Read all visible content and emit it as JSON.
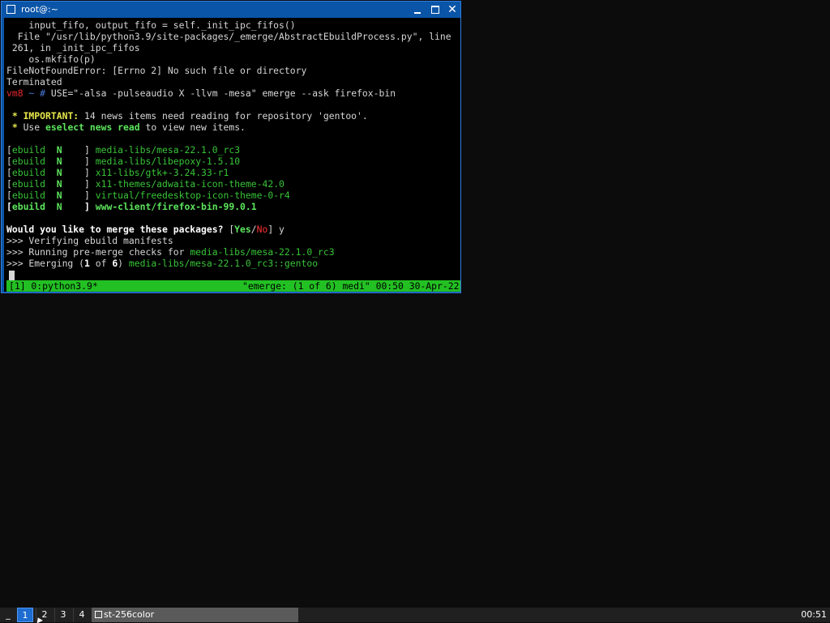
{
  "window": {
    "title": "root@:~"
  },
  "terminal": {
    "lines": [
      [
        {
          "t": "    input_fifo, output_fifo = self._init_ipc_fifos()",
          "c": ""
        }
      ],
      [
        {
          "t": "  File \"/usr/lib/python3.9/site-packages/_emerge/AbstractEbuildProcess.py\", line",
          "c": ""
        }
      ],
      [
        {
          "t": " 261, in _init_ipc_fifos",
          "c": ""
        }
      ],
      [
        {
          "t": "    os.mkfifo(p)",
          "c": ""
        }
      ],
      [
        {
          "t": "FileNotFoundError: [Errno 2] No such file or directory",
          "c": ""
        }
      ],
      [
        {
          "t": "Terminated",
          "c": ""
        }
      ],
      [
        {
          "t": "vm8",
          "c": "red"
        },
        {
          "t": " ~ # ",
          "c": "blue"
        },
        {
          "t": "USE=\"-alsa -pulseaudio X -llvm -mesa\" emerge --ask firefox-bin",
          "c": ""
        }
      ],
      [
        {
          "t": "",
          "c": ""
        }
      ],
      [
        {
          "t": " * ",
          "c": "yellow"
        },
        {
          "t": "IMPORTANT:",
          "c": "yellow"
        },
        {
          "t": " 14 news items need reading for repository 'gentoo'.",
          "c": ""
        }
      ],
      [
        {
          "t": " * ",
          "c": "yellow"
        },
        {
          "t": "Use ",
          "c": ""
        },
        {
          "t": "eselect news read",
          "c": "bgreen"
        },
        {
          "t": " to view new items.",
          "c": ""
        }
      ],
      [
        {
          "t": "",
          "c": ""
        }
      ],
      [
        {
          "t": "[",
          "c": ""
        },
        {
          "t": "ebuild",
          "c": "green"
        },
        {
          "t": "  ",
          "c": ""
        },
        {
          "t": "N",
          "c": "bgreen"
        },
        {
          "t": "    ] ",
          "c": ""
        },
        {
          "t": "media-libs/mesa-22.1.0_rc3",
          "c": "green"
        }
      ],
      [
        {
          "t": "[",
          "c": ""
        },
        {
          "t": "ebuild",
          "c": "green"
        },
        {
          "t": "  ",
          "c": ""
        },
        {
          "t": "N",
          "c": "bgreen"
        },
        {
          "t": "    ] ",
          "c": ""
        },
        {
          "t": "media-libs/libepoxy-1.5.10",
          "c": "green"
        }
      ],
      [
        {
          "t": "[",
          "c": ""
        },
        {
          "t": "ebuild",
          "c": "green"
        },
        {
          "t": "  ",
          "c": ""
        },
        {
          "t": "N",
          "c": "bgreen"
        },
        {
          "t": "    ] ",
          "c": ""
        },
        {
          "t": "x11-libs/gtk+-3.24.33-r1",
          "c": "green"
        }
      ],
      [
        {
          "t": "[",
          "c": ""
        },
        {
          "t": "ebuild",
          "c": "green"
        },
        {
          "t": "  ",
          "c": ""
        },
        {
          "t": "N",
          "c": "bgreen"
        },
        {
          "t": "    ] ",
          "c": ""
        },
        {
          "t": "x11-themes/adwaita-icon-theme-42.0",
          "c": "green"
        }
      ],
      [
        {
          "t": "[",
          "c": ""
        },
        {
          "t": "ebuild",
          "c": "green"
        },
        {
          "t": "  ",
          "c": ""
        },
        {
          "t": "N",
          "c": "bgreen"
        },
        {
          "t": "    ] ",
          "c": ""
        },
        {
          "t": "virtual/freedesktop-icon-theme-0-r4",
          "c": "green"
        }
      ],
      [
        {
          "t": "[",
          "c": "bwhite"
        },
        {
          "t": "ebuild",
          "c": "bgreen"
        },
        {
          "t": "  ",
          "c": ""
        },
        {
          "t": "N",
          "c": "bgreen"
        },
        {
          "t": "    ] ",
          "c": "bwhite"
        },
        {
          "t": "www-client/firefox-bin-99.0.1",
          "c": "bgreen"
        }
      ],
      [
        {
          "t": "",
          "c": ""
        }
      ],
      [
        {
          "t": "Would you like to merge these packages? ",
          "c": "bwhite"
        },
        {
          "t": "[",
          "c": ""
        },
        {
          "t": "Yes",
          "c": "bgreen"
        },
        {
          "t": "/",
          "c": ""
        },
        {
          "t": "No",
          "c": "bred"
        },
        {
          "t": "] y",
          "c": ""
        }
      ],
      [
        {
          "t": ">>> Verifying ebuild manifests",
          "c": ""
        }
      ],
      [
        {
          "t": ">>> Running pre-merge checks for ",
          "c": ""
        },
        {
          "t": "media-libs/mesa-22.1.0_rc3",
          "c": "green"
        }
      ],
      [
        {
          "t": ">>> Emerging (",
          "c": ""
        },
        {
          "t": "1",
          "c": "bwhite"
        },
        {
          "t": " of ",
          "c": ""
        },
        {
          "t": "6",
          "c": "bwhite"
        },
        {
          "t": ") ",
          "c": ""
        },
        {
          "t": "media-libs/mesa-22.1.0_rc3::gentoo",
          "c": "green"
        }
      ]
    ]
  },
  "statusbar": {
    "left": "[1] 0:python3.9*",
    "right": "\"emerge: (1 of 6) medi\" 00:50 30-Apr-22"
  },
  "taskbar": {
    "menu_label": "_",
    "workspaces": [
      "1",
      "2",
      "3",
      "4"
    ],
    "task_label": "st-256color",
    "clock": "00:51"
  },
  "colors": {
    "titlebar": "#0b55a8",
    "status_green": "#23c023",
    "taskbar": "#202020"
  }
}
